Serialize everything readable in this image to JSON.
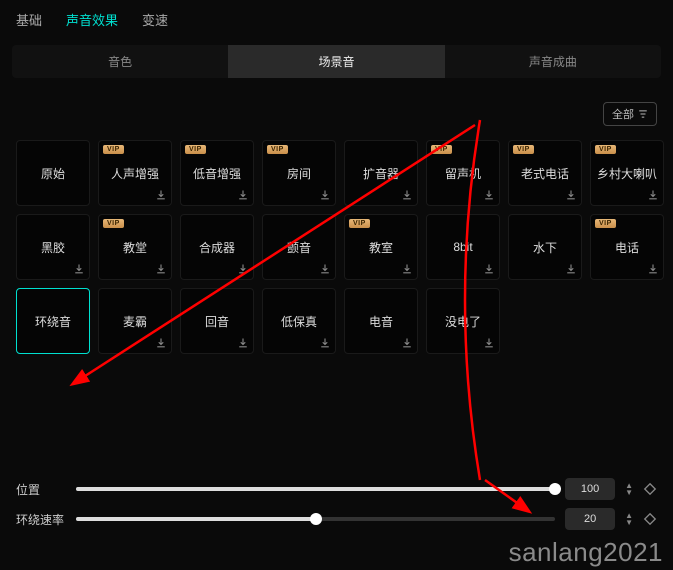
{
  "topTabs": [
    {
      "label": "基础",
      "active": false
    },
    {
      "label": "声音效果",
      "active": true
    },
    {
      "label": "变速",
      "active": false
    }
  ],
  "subTabs": [
    {
      "label": "音色",
      "active": false
    },
    {
      "label": "场景音",
      "active": true
    },
    {
      "label": "声音成曲",
      "active": false
    }
  ],
  "filter": {
    "label": "全部"
  },
  "vipBadge": "VIP",
  "tiles": [
    {
      "label": "原始",
      "vip": false,
      "dl": false,
      "selected": false
    },
    {
      "label": "人声增强",
      "vip": true,
      "dl": true,
      "selected": false
    },
    {
      "label": "低音增强",
      "vip": true,
      "dl": true,
      "selected": false
    },
    {
      "label": "房间",
      "vip": true,
      "dl": true,
      "selected": false
    },
    {
      "label": "扩音器",
      "vip": false,
      "dl": true,
      "selected": false
    },
    {
      "label": "留声机",
      "vip": true,
      "dl": true,
      "selected": false
    },
    {
      "label": "老式电话",
      "vip": true,
      "dl": true,
      "selected": false
    },
    {
      "label": "乡村大喇叭",
      "vip": true,
      "dl": true,
      "selected": false
    },
    {
      "label": "黑胶",
      "vip": false,
      "dl": true,
      "selected": false
    },
    {
      "label": "教堂",
      "vip": true,
      "dl": true,
      "selected": false
    },
    {
      "label": "合成器",
      "vip": false,
      "dl": true,
      "selected": false
    },
    {
      "label": "颤音",
      "vip": false,
      "dl": true,
      "selected": false
    },
    {
      "label": "教室",
      "vip": true,
      "dl": true,
      "selected": false
    },
    {
      "label": "8bit",
      "vip": false,
      "dl": true,
      "selected": false
    },
    {
      "label": "水下",
      "vip": false,
      "dl": true,
      "selected": false
    },
    {
      "label": "电话",
      "vip": true,
      "dl": true,
      "selected": false
    },
    {
      "label": "环绕音",
      "vip": false,
      "dl": false,
      "selected": true
    },
    {
      "label": "麦霸",
      "vip": false,
      "dl": true,
      "selected": false
    },
    {
      "label": "回音",
      "vip": false,
      "dl": true,
      "selected": false
    },
    {
      "label": "低保真",
      "vip": false,
      "dl": true,
      "selected": false
    },
    {
      "label": "电音",
      "vip": false,
      "dl": true,
      "selected": false
    },
    {
      "label": "没电了",
      "vip": false,
      "dl": true,
      "selected": false
    }
  ],
  "sliders": {
    "position": {
      "label": "位置",
      "value": 100,
      "percent": 100
    },
    "speed": {
      "label": "环绕速率",
      "value": 20,
      "percent": 50
    }
  },
  "watermark": "sanlang2021"
}
